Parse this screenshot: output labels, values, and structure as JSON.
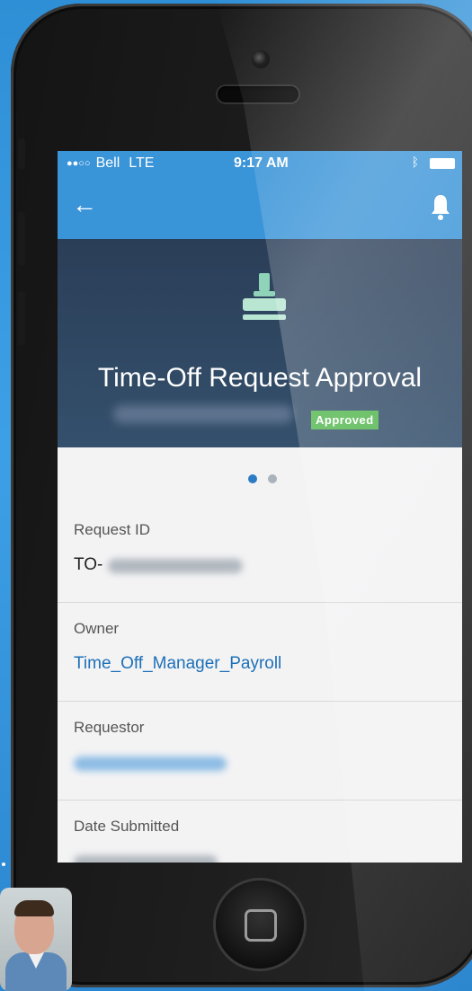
{
  "status_bar": {
    "signal": "●●○○",
    "carrier": "Bell",
    "network": "LTE",
    "time": "9:17 AM",
    "bluetooth_icon": "bluetooth-icon",
    "battery_icon": "battery-icon"
  },
  "nav": {
    "back_icon": "back-arrow-icon",
    "notifications_icon": "bell-icon"
  },
  "hero": {
    "icon": "stamp-icon",
    "title": "Time-Off Request Approval",
    "status_badge": "Approved"
  },
  "pagination": {
    "total": 2,
    "active": 1
  },
  "fields": [
    {
      "label": "Request ID",
      "value": "TO-"
    },
    {
      "label": "Owner",
      "value": "Time_Off_Manager_Payroll"
    },
    {
      "label": "Requestor",
      "value": ""
    },
    {
      "label": "Date Submitted",
      "value": ""
    }
  ],
  "colors": {
    "accent": "#3a94d8",
    "hero_bg": "#2b3e58",
    "badge": "#53b74f",
    "link": "#1d70b8"
  }
}
